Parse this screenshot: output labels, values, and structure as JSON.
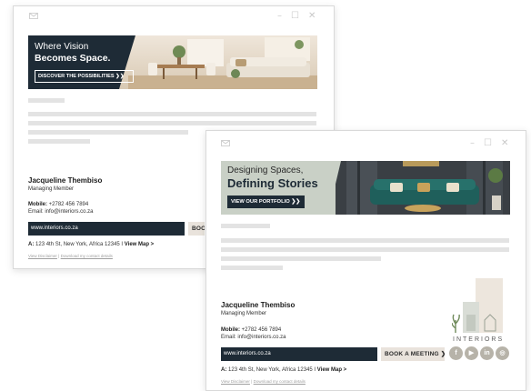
{
  "back_window": {
    "banner": {
      "line1": "Where Vision",
      "line2": "Becomes Space.",
      "cta": "DISCOVER THE POSSIBILITIES ❯❯"
    },
    "signature": {
      "name": "Jacqueline Thembiso",
      "role": "Managing Member",
      "mobile_label": "Mobile:",
      "mobile": "+2782 456 7894",
      "email_label": "Email:",
      "email": "info@interiors.co.za",
      "url": "www.interiors.co.za",
      "book": "BOOK",
      "address_label": "A:",
      "address": "123 4th St, New York, Africa 12345",
      "separator": "I",
      "view_map": "View Map >",
      "disclaimer": "View Disclaimer",
      "link_sep": "|",
      "download": "Download my contact details"
    }
  },
  "front_window": {
    "banner": {
      "line1": "Designing Spaces,",
      "line2": "Defining Stories",
      "cta": "VIEW OUR PORTFOLIO ❯❯"
    },
    "signature": {
      "name": "Jacqueline Thembiso",
      "role": "Managing Member",
      "mobile_label": "Mobile:",
      "mobile": "+2782 456 7894",
      "email_label": "Email:",
      "email": "info@interiors.co.za",
      "url": "www.interiors.co.za",
      "book": "BOOK A MEETING ❯❯",
      "address_label": "A:",
      "address": "123 4th St, New York, Africa 12345",
      "separator": "I",
      "view_map": "View Map >",
      "disclaimer": "View Disclaimer",
      "link_sep": "|",
      "download": "Download my contact details",
      "brand": "INTERIORS",
      "social": [
        "f",
        "▶",
        "in",
        "◎"
      ]
    }
  },
  "window_controls": [
    "–",
    "☐",
    "✕"
  ],
  "colors": {
    "navy": "#1e2b36",
    "sage": "#c9d0c6",
    "beige": "#e9e3dc",
    "teal_sofa": "#1f5f5b",
    "placeholder_bar": "#e3e3e3",
    "social_grey": "#b7b3a9"
  }
}
